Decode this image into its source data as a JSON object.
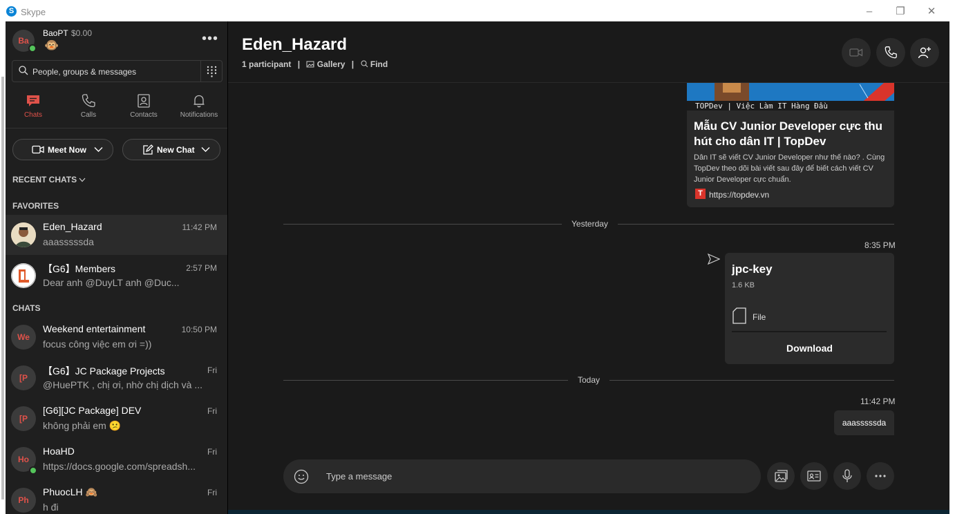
{
  "window": {
    "title": "Skype",
    "logo": "S"
  },
  "profile": {
    "initials": "Ba",
    "name": "BaoPT",
    "balance": "$0.00",
    "mood": "🐵"
  },
  "search": {
    "placeholder": "People, groups & messages"
  },
  "nav": [
    {
      "label": "Chats",
      "icon": "chat-icon",
      "active": true
    },
    {
      "label": "Calls",
      "icon": "phone-icon"
    },
    {
      "label": "Contacts",
      "icon": "contacts-icon"
    },
    {
      "label": "Notifications",
      "icon": "bell-icon"
    }
  ],
  "actions": {
    "meet_now": "Meet Now",
    "new_chat": "New Chat"
  },
  "sections": {
    "recent": "RECENT CHATS",
    "favorites": "FAVORITES",
    "chats": "CHATS"
  },
  "favorites": [
    {
      "name": "Eden_Hazard",
      "time": "11:42 PM",
      "preview": "aaasssssda"
    },
    {
      "name": "【G6】Members",
      "time": "2:57 PM",
      "preview": "Dear anh @DuyLT anh @Duc..."
    }
  ],
  "chats": [
    {
      "initials": "We",
      "name": "Weekend entertainment",
      "time": "10:50 PM",
      "preview": "focus công việc em ơi =))"
    },
    {
      "initials": "[P",
      "name": "【G6】JC Package Projects",
      "time": "Fri",
      "preview": "@HuePTK , chị ơi, nhờ chị dịch và ..."
    },
    {
      "initials": "[P",
      "name": "[G6][JC Package] DEV",
      "time": "Fri",
      "preview": "không phải em 😕"
    },
    {
      "initials": "Ho",
      "name": "HoaHD",
      "time": "Fri",
      "preview": "https://docs.google.com/spreadsh..."
    },
    {
      "initials": "Ph",
      "name": "PhuocLH 🙈",
      "time": "Fri",
      "preview": "h đi"
    }
  ],
  "conversation": {
    "title": "Eden_Hazard",
    "participants": "1 participant",
    "gallery": "Gallery",
    "find": "Find"
  },
  "link_preview": {
    "banner_text": "TOPDev | Việc Làm IT Hàng Đầu",
    "title": "Mẫu CV Junior Developer cực thu hút cho dân IT | TopDev",
    "description": "Dân IT sẽ viết CV Junior Developer như thế nào? . Cùng TopDev theo dõi bài viết sau đây để biết cách viết CV Junior Developer cực chuẩn.",
    "favicon": "T",
    "url": "https://topdev.vn"
  },
  "messages": {
    "day1": "Yesterday",
    "file_time": "8:35 PM",
    "file": {
      "name": "jpc-key",
      "size": "1.6 KB",
      "type": "File",
      "action": "Download"
    },
    "day2": "Today",
    "text_time": "11:42 PM",
    "text": "aaasssssda"
  },
  "composer": {
    "placeholder": "Type a message"
  },
  "colors": {
    "accent": "#e0524a",
    "online": "#54c55b",
    "skype_blue": "#0a84d6"
  }
}
